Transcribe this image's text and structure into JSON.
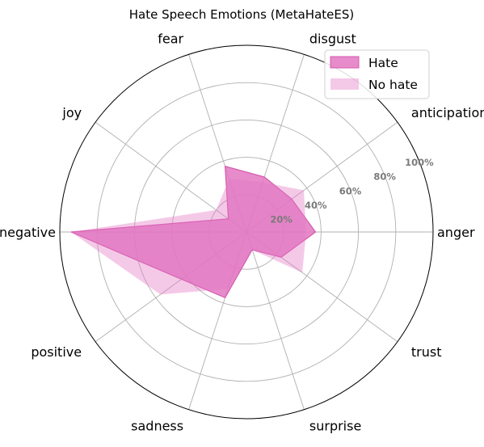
{
  "chart_data": {
    "type": "radar",
    "title": "Hate Speech Emotions (MetaHateES)",
    "categories": [
      "anger",
      "anticipation",
      "disgust",
      "fear",
      "joy",
      "negative",
      "positive",
      "sadness",
      "surprise",
      "trust"
    ],
    "radial_ticks": [
      "20%",
      "40%",
      "60%",
      "80%",
      "100%"
    ],
    "radial_tick_values": [
      20,
      40,
      60,
      80,
      100
    ],
    "rlim": [
      0,
      100
    ],
    "grid": true,
    "legend_position": "top-right",
    "series": [
      {
        "name": "Hate",
        "values": [
          37,
          30,
          31,
          37,
          12,
          94,
          43,
          37,
          10,
          23
        ],
        "color": "#e377c2",
        "fill_opacity": 0.85
      },
      {
        "name": "No hate",
        "values": [
          32,
          38,
          28,
          30,
          20,
          94,
          57,
          32,
          10,
          37
        ],
        "color": "#e377c2",
        "fill_opacity": 0.4
      }
    ]
  }
}
